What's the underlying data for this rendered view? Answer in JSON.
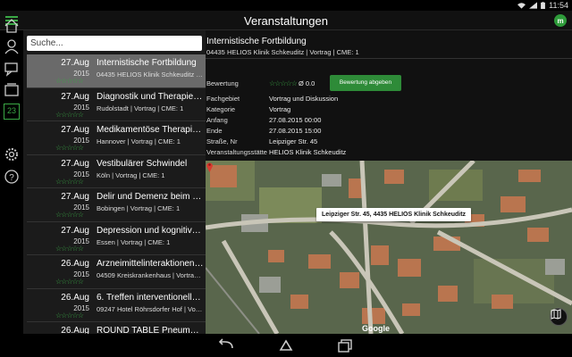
{
  "status_bar": {
    "time": "11:54"
  },
  "app_bar": {
    "title": "Veranstaltungen",
    "app_icon_letter": "m"
  },
  "left_nav": {
    "items": [
      {
        "icon": "home-icon"
      },
      {
        "icon": "profile-icon"
      },
      {
        "icon": "chat-icon"
      },
      {
        "icon": "folder-icon"
      },
      {
        "icon": "calendar-icon",
        "label": "23"
      },
      {
        "icon": "settings-icon"
      },
      {
        "icon": "help-icon"
      }
    ]
  },
  "search": {
    "placeholder": "Suche..."
  },
  "events": [
    {
      "date": "27.Aug",
      "year": "2015",
      "title": "Internistische Fortbildung",
      "subtitle": "04435 HELIOS Klinik Schkeuditz | Vortrag | CME: 1",
      "stars": "☆☆☆☆☆",
      "selected": true
    },
    {
      "date": "27.Aug",
      "year": "2015",
      "title": "Diagnostik und Therapie de...",
      "subtitle": "Rudolstadt | Vortrag | CME: 1",
      "stars": "☆☆☆☆☆"
    },
    {
      "date": "27.Aug",
      "year": "2015",
      "title": "Medikamentöse Therapie v...",
      "subtitle": "Hannover | Vortrag | CME: 1",
      "stars": "☆☆☆☆☆"
    },
    {
      "date": "27.Aug",
      "year": "2015",
      "title": "Vestibulärer Schwindel",
      "subtitle": "Köln | Vortrag | CME: 1",
      "stars": "☆☆☆☆☆"
    },
    {
      "date": "27.Aug",
      "year": "2015",
      "title": "Delir und Demenz beim älte...",
      "subtitle": "Bobingen | Vortrag | CME: 1",
      "stars": "☆☆☆☆☆"
    },
    {
      "date": "27.Aug",
      "year": "2015",
      "title": "Depression und kognitive S...",
      "subtitle": "Essen | Vortrag | CME: 1",
      "stars": "☆☆☆☆☆"
    },
    {
      "date": "26.Aug",
      "year": "2015",
      "title": "Arzneimittelinteraktionen b...",
      "subtitle": "04509 Kreiskrankenhaus | Vortrag | CME: 1",
      "stars": "☆☆☆☆☆"
    },
    {
      "date": "26.Aug",
      "year": "2015",
      "title": "6. Treffen interventioneller...",
      "subtitle": "09247 Hotel Röhrsdorfer Hof | Vortrag | CME: 1",
      "stars": "☆☆☆☆☆"
    },
    {
      "date": "26.Aug",
      "year": "2015",
      "title": "ROUND TABLE Pneumolog...",
      "subtitle": "",
      "stars": ""
    }
  ],
  "detail": {
    "title": "Internistische Fortbildung",
    "subtitle": "04435 HELIOS Klinik Schkeuditz | Vortrag | CME: 1",
    "rating_label": "Bewertung",
    "rating_stars": "☆☆☆☆☆",
    "rating_value": "Ø 0.0",
    "rate_button": "Bewertung abgeben",
    "fields": [
      {
        "key": "Fachgebiet",
        "value": "Vortrag und Diskussion"
      },
      {
        "key": "Kategorie",
        "value": "Vortrag"
      },
      {
        "key": "Anfang",
        "value": "27.08.2015 00:00"
      },
      {
        "key": "Ende",
        "value": "27.08.2015 15:00"
      },
      {
        "key": "Straße, Nr",
        "value": "Leipziger Str. 45"
      },
      {
        "key": "Veranstaltungsstätte",
        "value": "HELIOS Klinik Schkeuditz"
      }
    ]
  },
  "map": {
    "marker_label": "Leipziger Str. 45, 4435 HELIOS Klinik Schkeuditz",
    "attribution": "Google",
    "pin_color": "#d93a2f"
  },
  "colors": {
    "accent": "#3aa845",
    "button": "#2e8b38",
    "selected_row": "#6a6a6a"
  }
}
